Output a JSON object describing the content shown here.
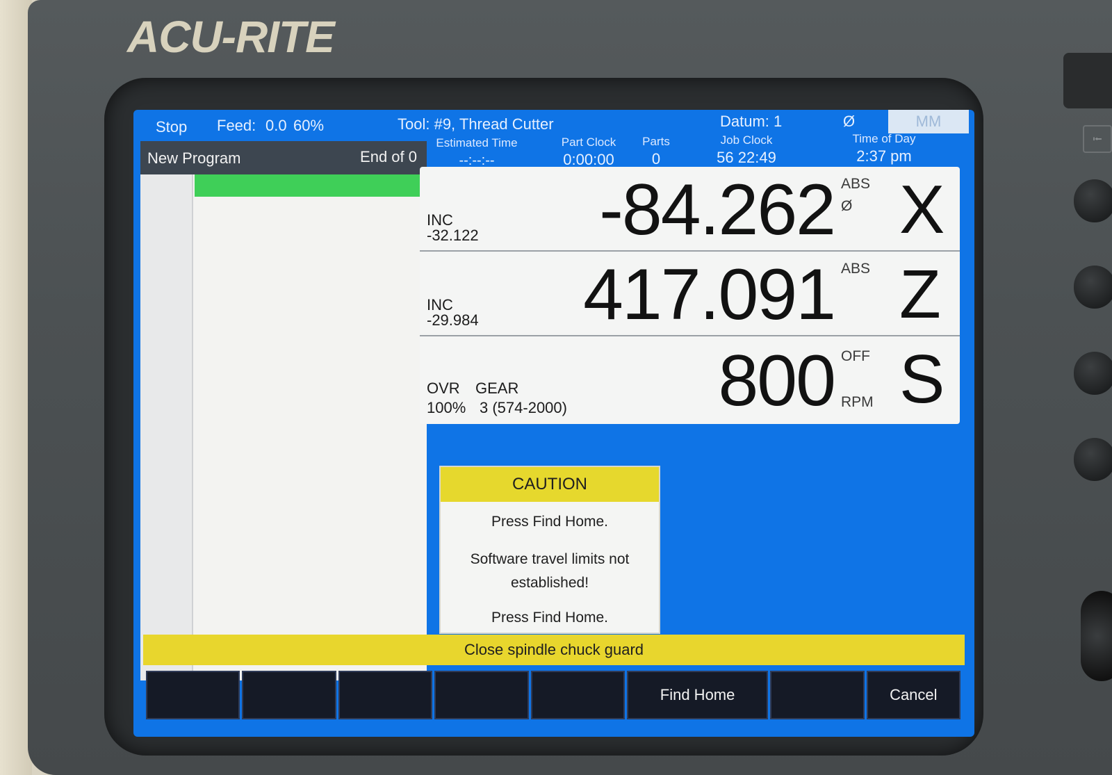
{
  "brand": "ACU-RITE",
  "status_bar": {
    "mode": "Stop",
    "feed_label": "Feed:",
    "feed_value": "0.0",
    "feed_override": "60%",
    "tool": "Tool: #9, Thread Cutter",
    "datum": "Datum: 1",
    "diameter_symbol": "Ø",
    "units": "MM"
  },
  "info": {
    "estimated_time_label": "Estimated Time",
    "estimated_time_value": "--:--:--",
    "part_clock_label": "Part Clock",
    "part_clock_value": "0:00:00",
    "parts_label": "Parts",
    "parts_value": "0",
    "job_clock_label": "Job Clock",
    "job_clock_value": "56 22:49",
    "time_of_day_label": "Time of Day",
    "time_of_day_value": "2:37 pm"
  },
  "program": {
    "name": "New Program",
    "position": "End of 0"
  },
  "axes": {
    "x": {
      "inc_label": "INC",
      "inc_value": "-32.122",
      "value": "-84.262",
      "mode": "ABS",
      "diameter": "Ø",
      "letter": "X"
    },
    "z": {
      "inc_label": "INC",
      "inc_value": "-29.984",
      "value": "417.091",
      "mode": "ABS",
      "letter": "Z"
    },
    "s": {
      "ovr_label": "OVR",
      "ovr_value": "100%",
      "gear_label": "GEAR",
      "gear_value": "3 (574-2000)",
      "value": "800",
      "state": "OFF",
      "unit": "RPM",
      "letter": "S"
    }
  },
  "caution": {
    "title": "CAUTION",
    "line1": "Press Find Home.",
    "line2": "Software travel limits not established!",
    "line3": "Press Find Home."
  },
  "message": "Close spindle chuck guard",
  "softkeys": {
    "find_home": "Find Home",
    "cancel": "Cancel"
  },
  "colors": {
    "screen_background": "#0f74e6",
    "caution_header": "#e6d82d",
    "program_highlight": "#3fcf58",
    "softkey_background": "#151a26"
  }
}
